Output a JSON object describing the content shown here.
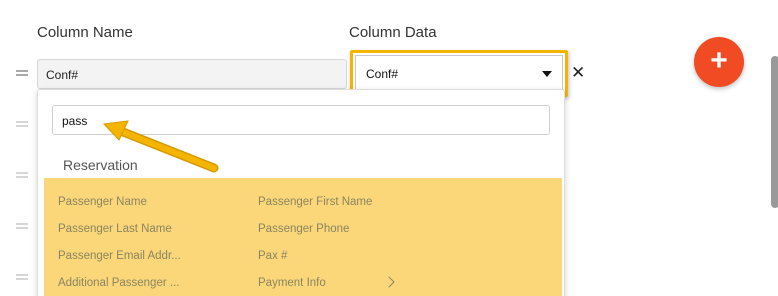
{
  "headers": {
    "column_name": "Column Name",
    "column_data": "Column Data"
  },
  "row": {
    "name_value": "Conf#",
    "data_value": "Conf#",
    "remove_label": "✕"
  },
  "dropdown": {
    "search_value": "pass",
    "group_label": "Reservation",
    "options": [
      "Passenger Name",
      "Passenger First Name",
      "Passenger Last Name",
      "Passenger Phone",
      "Passenger Email Addr...",
      "Pax #",
      "Additional Passenger ...",
      "Payment Info"
    ]
  },
  "fab": {
    "label": "+"
  },
  "icons": {
    "drag": "drag-handle-icon",
    "caret": "caret-down-icon",
    "close": "close-icon",
    "chevron": "chevron-right-icon",
    "add": "plus-icon"
  },
  "colors": {
    "highlight": "#fbd77a",
    "annotation": "#f5b400",
    "fab": "#f04b23"
  }
}
